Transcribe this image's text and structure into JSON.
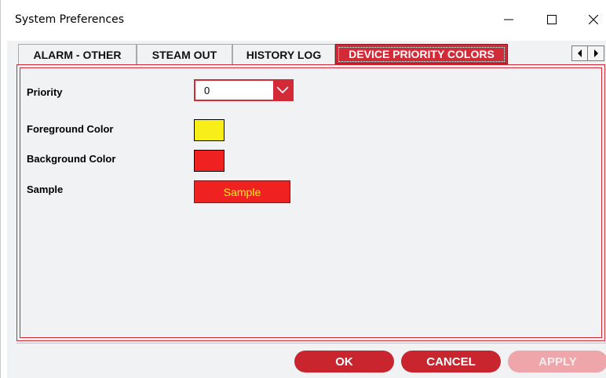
{
  "window": {
    "title": "System Preferences",
    "controls": {
      "minimize": "minimize-icon",
      "maximize": "maximize-icon",
      "close": "close-icon"
    }
  },
  "tabs": [
    {
      "label": "ALARM - OTHER",
      "active": false
    },
    {
      "label": "STEAM OUT",
      "active": false
    },
    {
      "label": "HISTORY LOG",
      "active": false
    },
    {
      "label": "DEVICE PRIORITY COLORS",
      "active": true
    }
  ],
  "tab_scroll": {
    "left": "arrow-left-icon",
    "right": "arrow-right-icon"
  },
  "form": {
    "priority_label": "Priority",
    "priority_value": "0",
    "foreground_label": "Foreground Color",
    "foreground_color": "#f7ef17",
    "background_label": "Background Color",
    "background_color": "#ef2121",
    "sample_label": "Sample",
    "sample_text": "Sample"
  },
  "buttons": {
    "ok": "OK",
    "cancel": "CANCEL",
    "apply": "APPLY"
  },
  "colors": {
    "accent": "#d32a37",
    "button": "#c9252f",
    "button_disabled": "#eea6aa",
    "panel_bg": "#f1f2f4"
  }
}
